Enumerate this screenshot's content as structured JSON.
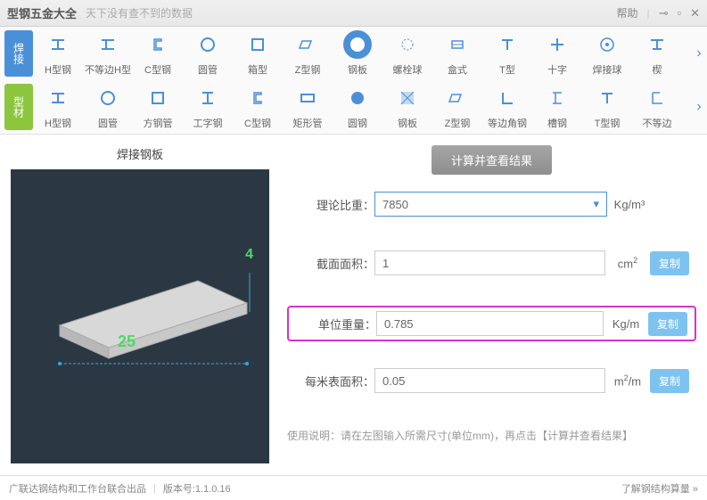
{
  "title": "型钢五金大全",
  "subtitle": "天下没有查不到的数据",
  "help_label": "帮助",
  "row1": {
    "label": "焊接",
    "items": [
      "H型钢",
      "不等边H型",
      "C型钢",
      "圆管",
      "箱型",
      "Z型钢",
      "钢板",
      "螺栓球",
      "盒式",
      "T型",
      "十字",
      "焊接球",
      "楔"
    ]
  },
  "row2": {
    "label": "型材",
    "items": [
      "H型钢",
      "圆管",
      "方钢管",
      "工字钢",
      "C型钢",
      "矩形管",
      "圆钢",
      "钢板",
      "Z型钢",
      "等边角钢",
      "槽钢",
      "T型钢",
      "不等边"
    ]
  },
  "preview_title": "焊接钢板",
  "dim_w": "4",
  "dim_l": "25",
  "calc_label": "计算并查看结果",
  "form": {
    "density_label": "理论比重：",
    "density_value": "7850",
    "density_unit": "Kg/m³",
    "area_label": "截面面积：",
    "area_value": "1",
    "area_unit_base": "cm",
    "area_unit_sup": "2",
    "weight_label": "单位重量：",
    "weight_value": "0.785",
    "weight_unit": "Kg/m",
    "surf_label": "每米表面积：",
    "surf_value": "0.05",
    "surf_unit_base": "m",
    "surf_unit_sup": "2",
    "surf_unit_suffix": "/m",
    "copy_label": "复制"
  },
  "hint": "使用说明：请在左图输入所需尺寸(单位mm)，再点击【计算并查看结果】",
  "status_left": "广联达钢结构和工作台联合出品",
  "version": "版本号:1.1.0.16",
  "status_right": "了解钢结构算量 »"
}
